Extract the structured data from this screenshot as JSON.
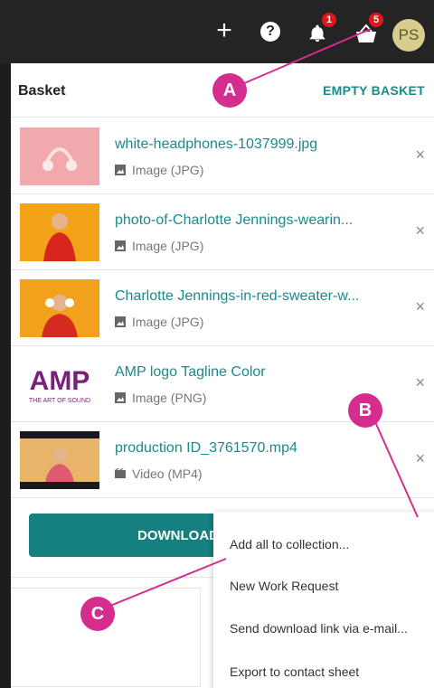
{
  "topbar": {
    "plus_icon": "plus-icon",
    "help_icon": "question-mark-icon",
    "help_glyph": "?",
    "notification_count": "1",
    "basket_count": "5",
    "avatar_initials": "PS"
  },
  "basket": {
    "title": "Basket",
    "empty_label": "EMPTY BASKET",
    "items": [
      {
        "name": "white-headphones-1037999.jpg",
        "type": "Image (JPG)",
        "kind": "image"
      },
      {
        "name": "photo-of-Charlotte Jennings-wearin...",
        "type": "Image (JPG)",
        "kind": "image"
      },
      {
        "name": "Charlotte Jennings-in-red-sweater-w...",
        "type": "Image (JPG)",
        "kind": "image"
      },
      {
        "name": "AMP logo Tagline Color",
        "type": "Image (PNG)",
        "kind": "image"
      },
      {
        "name": "production ID_3761570.mp4",
        "type": "Video (MP4)",
        "kind": "video"
      }
    ],
    "remove_glyph": "×",
    "download_label": "DOWNLOAD"
  },
  "menu": {
    "items": [
      "Add all to collection...",
      "New Work Request",
      "Send download link via e-mail...",
      "Export to contact sheet"
    ]
  },
  "callouts": {
    "a": "A",
    "b": "B",
    "c": "C"
  },
  "logo_text": {
    "amp": "AMP",
    "tagline": "THE ART OF SOUND"
  },
  "colors": {
    "accent": "#1a8a8a",
    "callout": "#d42d8e",
    "badge": "#e0161c",
    "topbar": "#242424"
  }
}
